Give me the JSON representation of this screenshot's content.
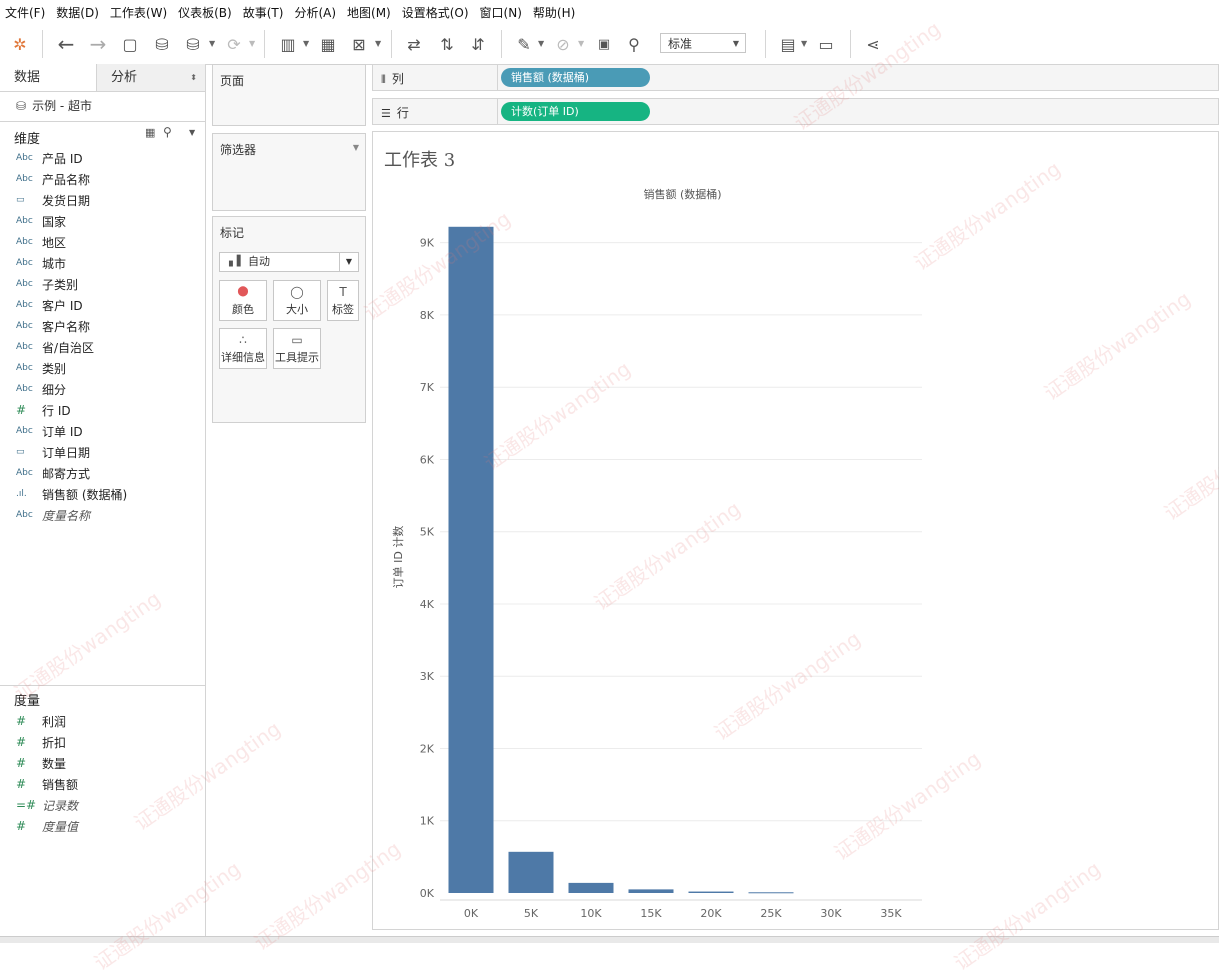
{
  "menu": [
    "文件(F)",
    "数据(D)",
    "工作表(W)",
    "仪表板(B)",
    "故事(T)",
    "分析(A)",
    "地图(M)",
    "设置格式(O)",
    "窗口(N)",
    "帮助(H)"
  ],
  "toolbar": {
    "fit_select": "标准"
  },
  "data_pane": {
    "tab_data": "数据",
    "tab_analysis": "分析",
    "datasource": "示例 - 超市",
    "dimensions_header": "维度",
    "dimensions": [
      {
        "type": "Abc",
        "name": "产品 ID"
      },
      {
        "type": "Abc",
        "name": "产品名称"
      },
      {
        "type": "date",
        "name": "发货日期"
      },
      {
        "type": "Abc",
        "name": "国家"
      },
      {
        "type": "Abc",
        "name": "地区"
      },
      {
        "type": "Abc",
        "name": "城市"
      },
      {
        "type": "Abc",
        "name": "子类别"
      },
      {
        "type": "Abc",
        "name": "客户 ID"
      },
      {
        "type": "Abc",
        "name": "客户名称"
      },
      {
        "type": "Abc",
        "name": "省/自治区"
      },
      {
        "type": "Abc",
        "name": "类别"
      },
      {
        "type": "Abc",
        "name": "细分"
      },
      {
        "type": "#",
        "name": "行 ID"
      },
      {
        "type": "Abc",
        "name": "订单 ID"
      },
      {
        "type": "date",
        "name": "订单日期"
      },
      {
        "type": "Abc",
        "name": "邮寄方式"
      },
      {
        "type": "bin",
        "name": "销售额 (数据桶)"
      },
      {
        "type": "Abc",
        "name": "度量名称",
        "italic": true
      }
    ],
    "measures_header": "度量",
    "measures": [
      {
        "type": "#",
        "name": "利润"
      },
      {
        "type": "#",
        "name": "折扣"
      },
      {
        "type": "#",
        "name": "数量"
      },
      {
        "type": "#",
        "name": "销售额"
      },
      {
        "type": "=#",
        "name": "记录数",
        "italic": true
      },
      {
        "type": "#",
        "name": "度量值",
        "italic": true
      }
    ]
  },
  "cards": {
    "pages": "页面",
    "filters": "筛选器",
    "marks": "标记",
    "mark_type": "自动",
    "mark_buttons": [
      {
        "label": "颜色",
        "icon": "color-icon"
      },
      {
        "label": "大小",
        "icon": "size-icon"
      },
      {
        "label": "标签",
        "icon": "label-icon"
      },
      {
        "label": "详细信息",
        "icon": "detail-icon"
      },
      {
        "label": "工具提示",
        "icon": "tooltip-icon"
      }
    ]
  },
  "shelves": {
    "columns_label": "列",
    "rows_label": "行",
    "columns_pill": "销售额 (数据桶)",
    "rows_pill": "计数(订单 ID)",
    "columns_pill_color": "#4a9bb6",
    "rows_pill_color": "#16b482"
  },
  "sheet_title": "工作表 3",
  "watermark": "证通股份wangting",
  "chart_data": {
    "type": "bar",
    "title": "销售额 (数据桶)",
    "xlabel": "",
    "ylabel": "订单 ID 计数",
    "categories": [
      "0K",
      "5K",
      "10K",
      "15K",
      "20K",
      "25K",
      "30K",
      "35K"
    ],
    "values": [
      9220,
      570,
      140,
      50,
      20,
      10,
      0,
      0
    ],
    "ylim": [
      0,
      9300
    ],
    "yticks": [
      0,
      1000,
      2000,
      3000,
      4000,
      5000,
      6000,
      7000,
      8000,
      9000
    ],
    "ytick_labels": [
      "0K",
      "1K",
      "2K",
      "3K",
      "4K",
      "5K",
      "6K",
      "7K",
      "8K",
      "9K"
    ],
    "bar_color": "#4e79a7",
    "grid": true
  }
}
